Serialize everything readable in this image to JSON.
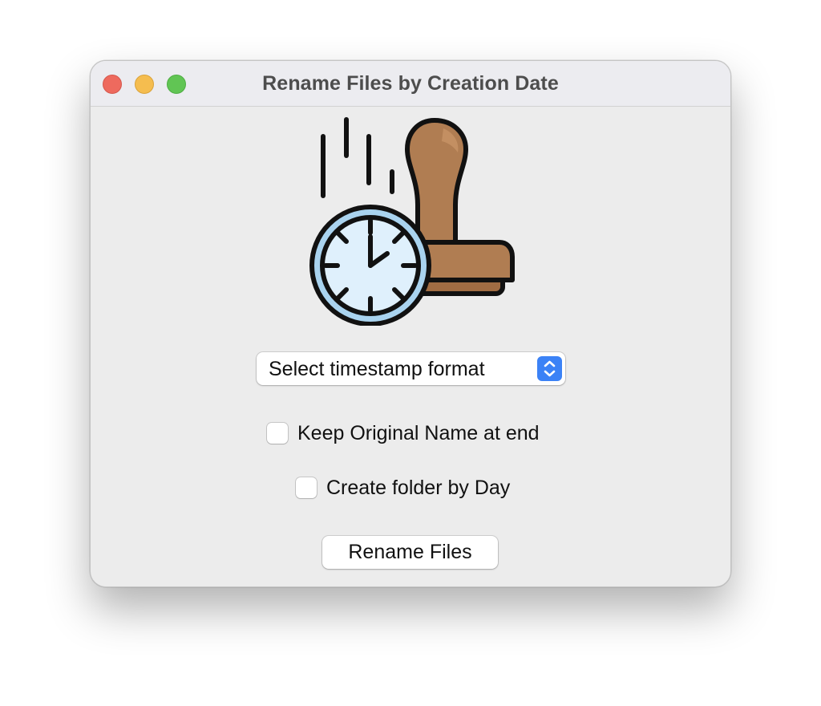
{
  "window": {
    "title": "Rename Files by Creation Date"
  },
  "traffic_lights": {
    "close": "close-icon",
    "minimize": "minimize-icon",
    "zoom": "zoom-icon"
  },
  "logo": {
    "icon": "clock-stamp-icon"
  },
  "timestamp_select": {
    "selected": "Select timestamp format",
    "icon": "chevron-up-down-icon"
  },
  "options": {
    "keep_original_label": "Keep Original Name at end",
    "keep_original_checked": false,
    "folder_by_day_label": "Create folder by Day",
    "folder_by_day_checked": false
  },
  "actions": {
    "rename_label": "Rename Files"
  },
  "colors": {
    "accent": "#3b82f6",
    "window_bg": "#ececec",
    "stamp_brown": "#b07d52",
    "clock_face": "#dff0fc"
  }
}
